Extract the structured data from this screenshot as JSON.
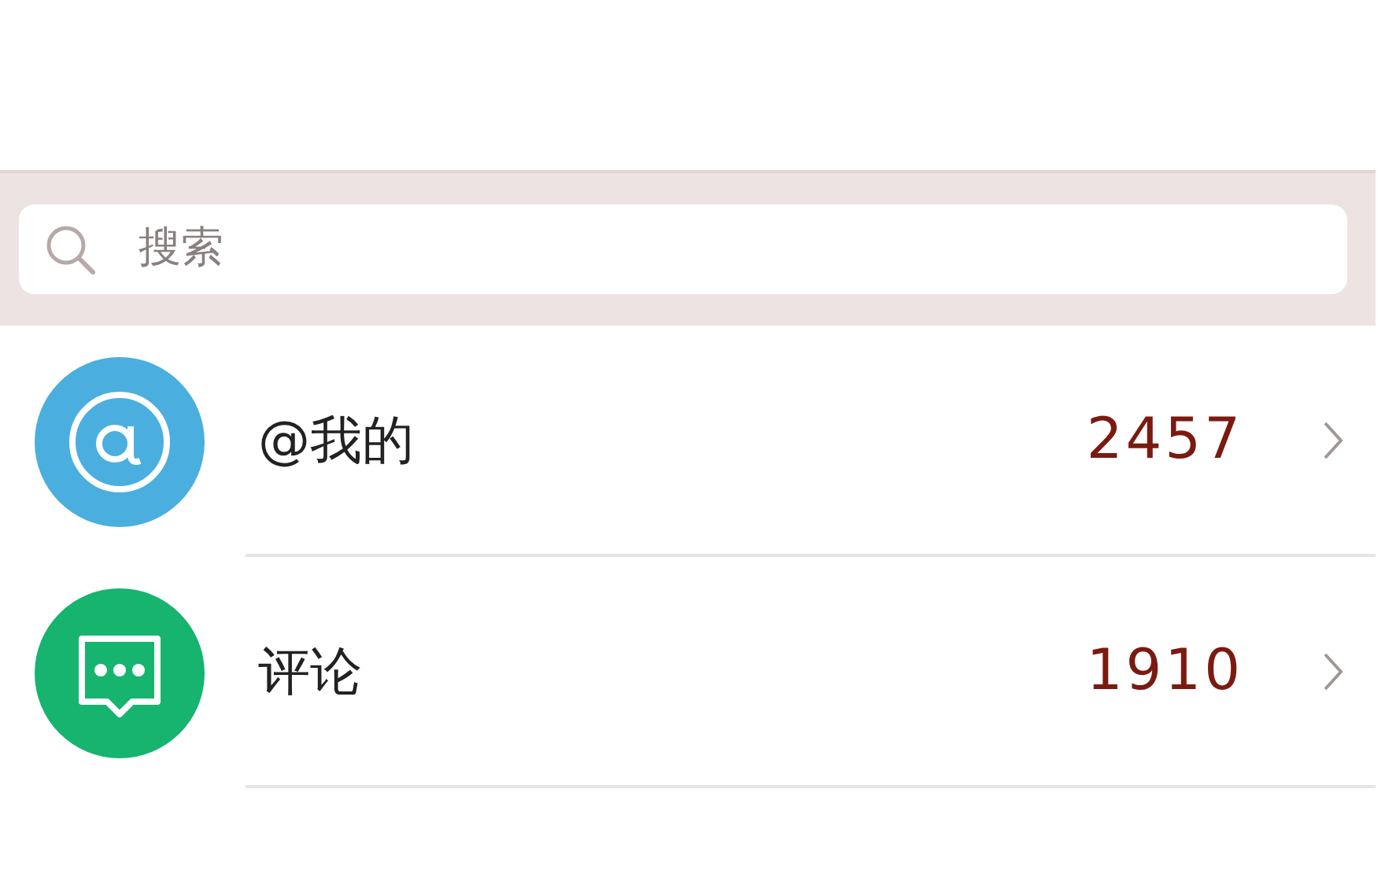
{
  "search": {
    "placeholder": "搜索"
  },
  "items": [
    {
      "kind": "mention",
      "label": "@我的",
      "count": "2457"
    },
    {
      "kind": "comment",
      "label": "评论",
      "count": "1910"
    }
  ]
}
